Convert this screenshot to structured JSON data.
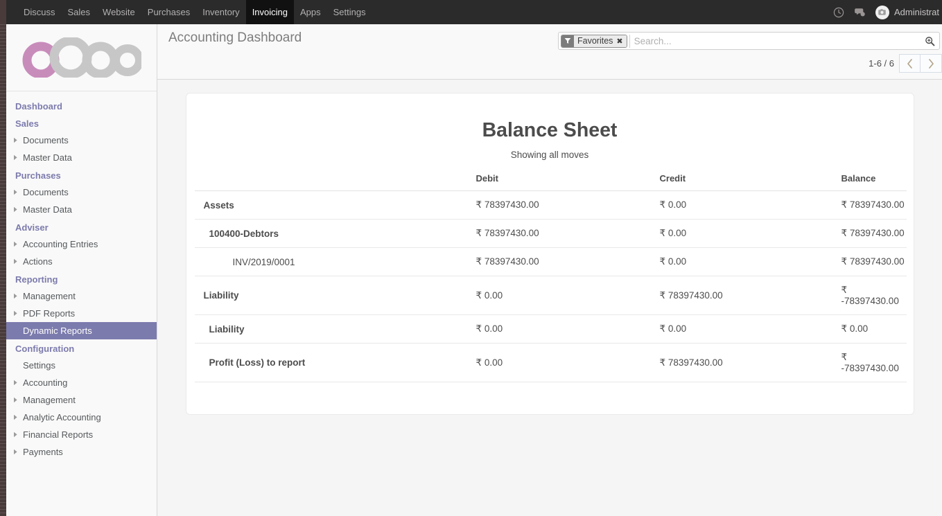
{
  "navbar": {
    "menus": [
      {
        "label": "Discuss",
        "active": false
      },
      {
        "label": "Sales",
        "active": false
      },
      {
        "label": "Website",
        "active": false
      },
      {
        "label": "Purchases",
        "active": false
      },
      {
        "label": "Inventory",
        "active": false
      },
      {
        "label": "Invoicing",
        "active": true
      },
      {
        "label": "Apps",
        "active": false
      },
      {
        "label": "Settings",
        "active": false
      }
    ],
    "icons": [
      "clock-icon",
      "chat-icon"
    ],
    "user": "Administrat",
    "avatar_icon": "avatar-placeholder-icon"
  },
  "sidebar": {
    "logo_alt": "odoo",
    "sections": [
      {
        "header": "Dashboard",
        "items": []
      },
      {
        "header": "Sales",
        "items": [
          {
            "label": "Documents",
            "caret": true,
            "selected": false
          },
          {
            "label": "Master Data",
            "caret": true,
            "selected": false
          }
        ]
      },
      {
        "header": "Purchases",
        "items": [
          {
            "label": "Documents",
            "caret": true,
            "selected": false
          },
          {
            "label": "Master Data",
            "caret": true,
            "selected": false
          }
        ]
      },
      {
        "header": "Adviser",
        "items": [
          {
            "label": "Accounting Entries",
            "caret": true,
            "selected": false
          },
          {
            "label": "Actions",
            "caret": true,
            "selected": false
          }
        ]
      },
      {
        "header": "Reporting",
        "items": [
          {
            "label": "Management",
            "caret": true,
            "selected": false
          },
          {
            "label": "PDF Reports",
            "caret": true,
            "selected": false
          },
          {
            "label": "Dynamic Reports",
            "caret": false,
            "selected": true
          }
        ]
      },
      {
        "header": "Configuration",
        "items": [
          {
            "label": "Settings",
            "caret": false,
            "selected": false
          },
          {
            "label": "Accounting",
            "caret": true,
            "selected": false
          },
          {
            "label": "Management",
            "caret": true,
            "selected": false
          },
          {
            "label": "Analytic Accounting",
            "caret": true,
            "selected": false
          },
          {
            "label": "Financial Reports",
            "caret": true,
            "selected": false
          },
          {
            "label": "Payments",
            "caret": true,
            "selected": false
          }
        ]
      }
    ]
  },
  "control_panel": {
    "breadcrumb": "Accounting Dashboard",
    "search": {
      "facet_label": "Favorites",
      "facet_icon": "filter-icon",
      "facet_close": "✖",
      "placeholder": "Search...",
      "value": "",
      "magnifier_icon": "search-icon"
    },
    "pager": {
      "count": "1-6 / 6",
      "previous_icon": "chevron-left-icon",
      "next_icon": "chevron-right-icon"
    }
  },
  "report": {
    "title": "Balance Sheet",
    "subtitle": "Showing all moves",
    "columns": [
      "",
      "Debit",
      "Credit",
      "Balance"
    ],
    "rows": [
      {
        "name": "Assets",
        "level": 0,
        "debit": "₹ 78397430.00",
        "credit": "₹ 0.00",
        "balance": "₹ 78397430.00"
      },
      {
        "name": "100400-Debtors",
        "level": 1,
        "debit": "₹ 78397430.00",
        "credit": "₹ 0.00",
        "balance": "₹ 78397430.00"
      },
      {
        "name": "INV/2019/0001",
        "level": 2,
        "debit": "₹ 78397430.00",
        "credit": "₹ 0.00",
        "balance": "₹ 78397430.00"
      },
      {
        "name": "Liability",
        "level": 0,
        "debit": "₹ 0.00",
        "credit": "₹ 78397430.00",
        "balance": "₹ -78397430.00"
      },
      {
        "name": "Liability",
        "level": 1,
        "debit": "₹ 0.00",
        "credit": "₹ 0.00",
        "balance": "₹ 0.00"
      },
      {
        "name": "Profit (Loss) to report",
        "level": 1,
        "debit": "₹ 0.00",
        "credit": "₹ 78397430.00",
        "balance": "₹ -78397430.00"
      }
    ]
  },
  "colors": {
    "navbar_bg": "#2b2b2b",
    "navbar_active_bg": "#111111",
    "sidebar_bg": "#f9f9f9",
    "accent_purple": "#7c7bad",
    "edge_brown": "#4a3b3b",
    "content_bg": "#f5f5f5",
    "card_bg": "#ffffff",
    "text": "#4c4c4c"
  }
}
